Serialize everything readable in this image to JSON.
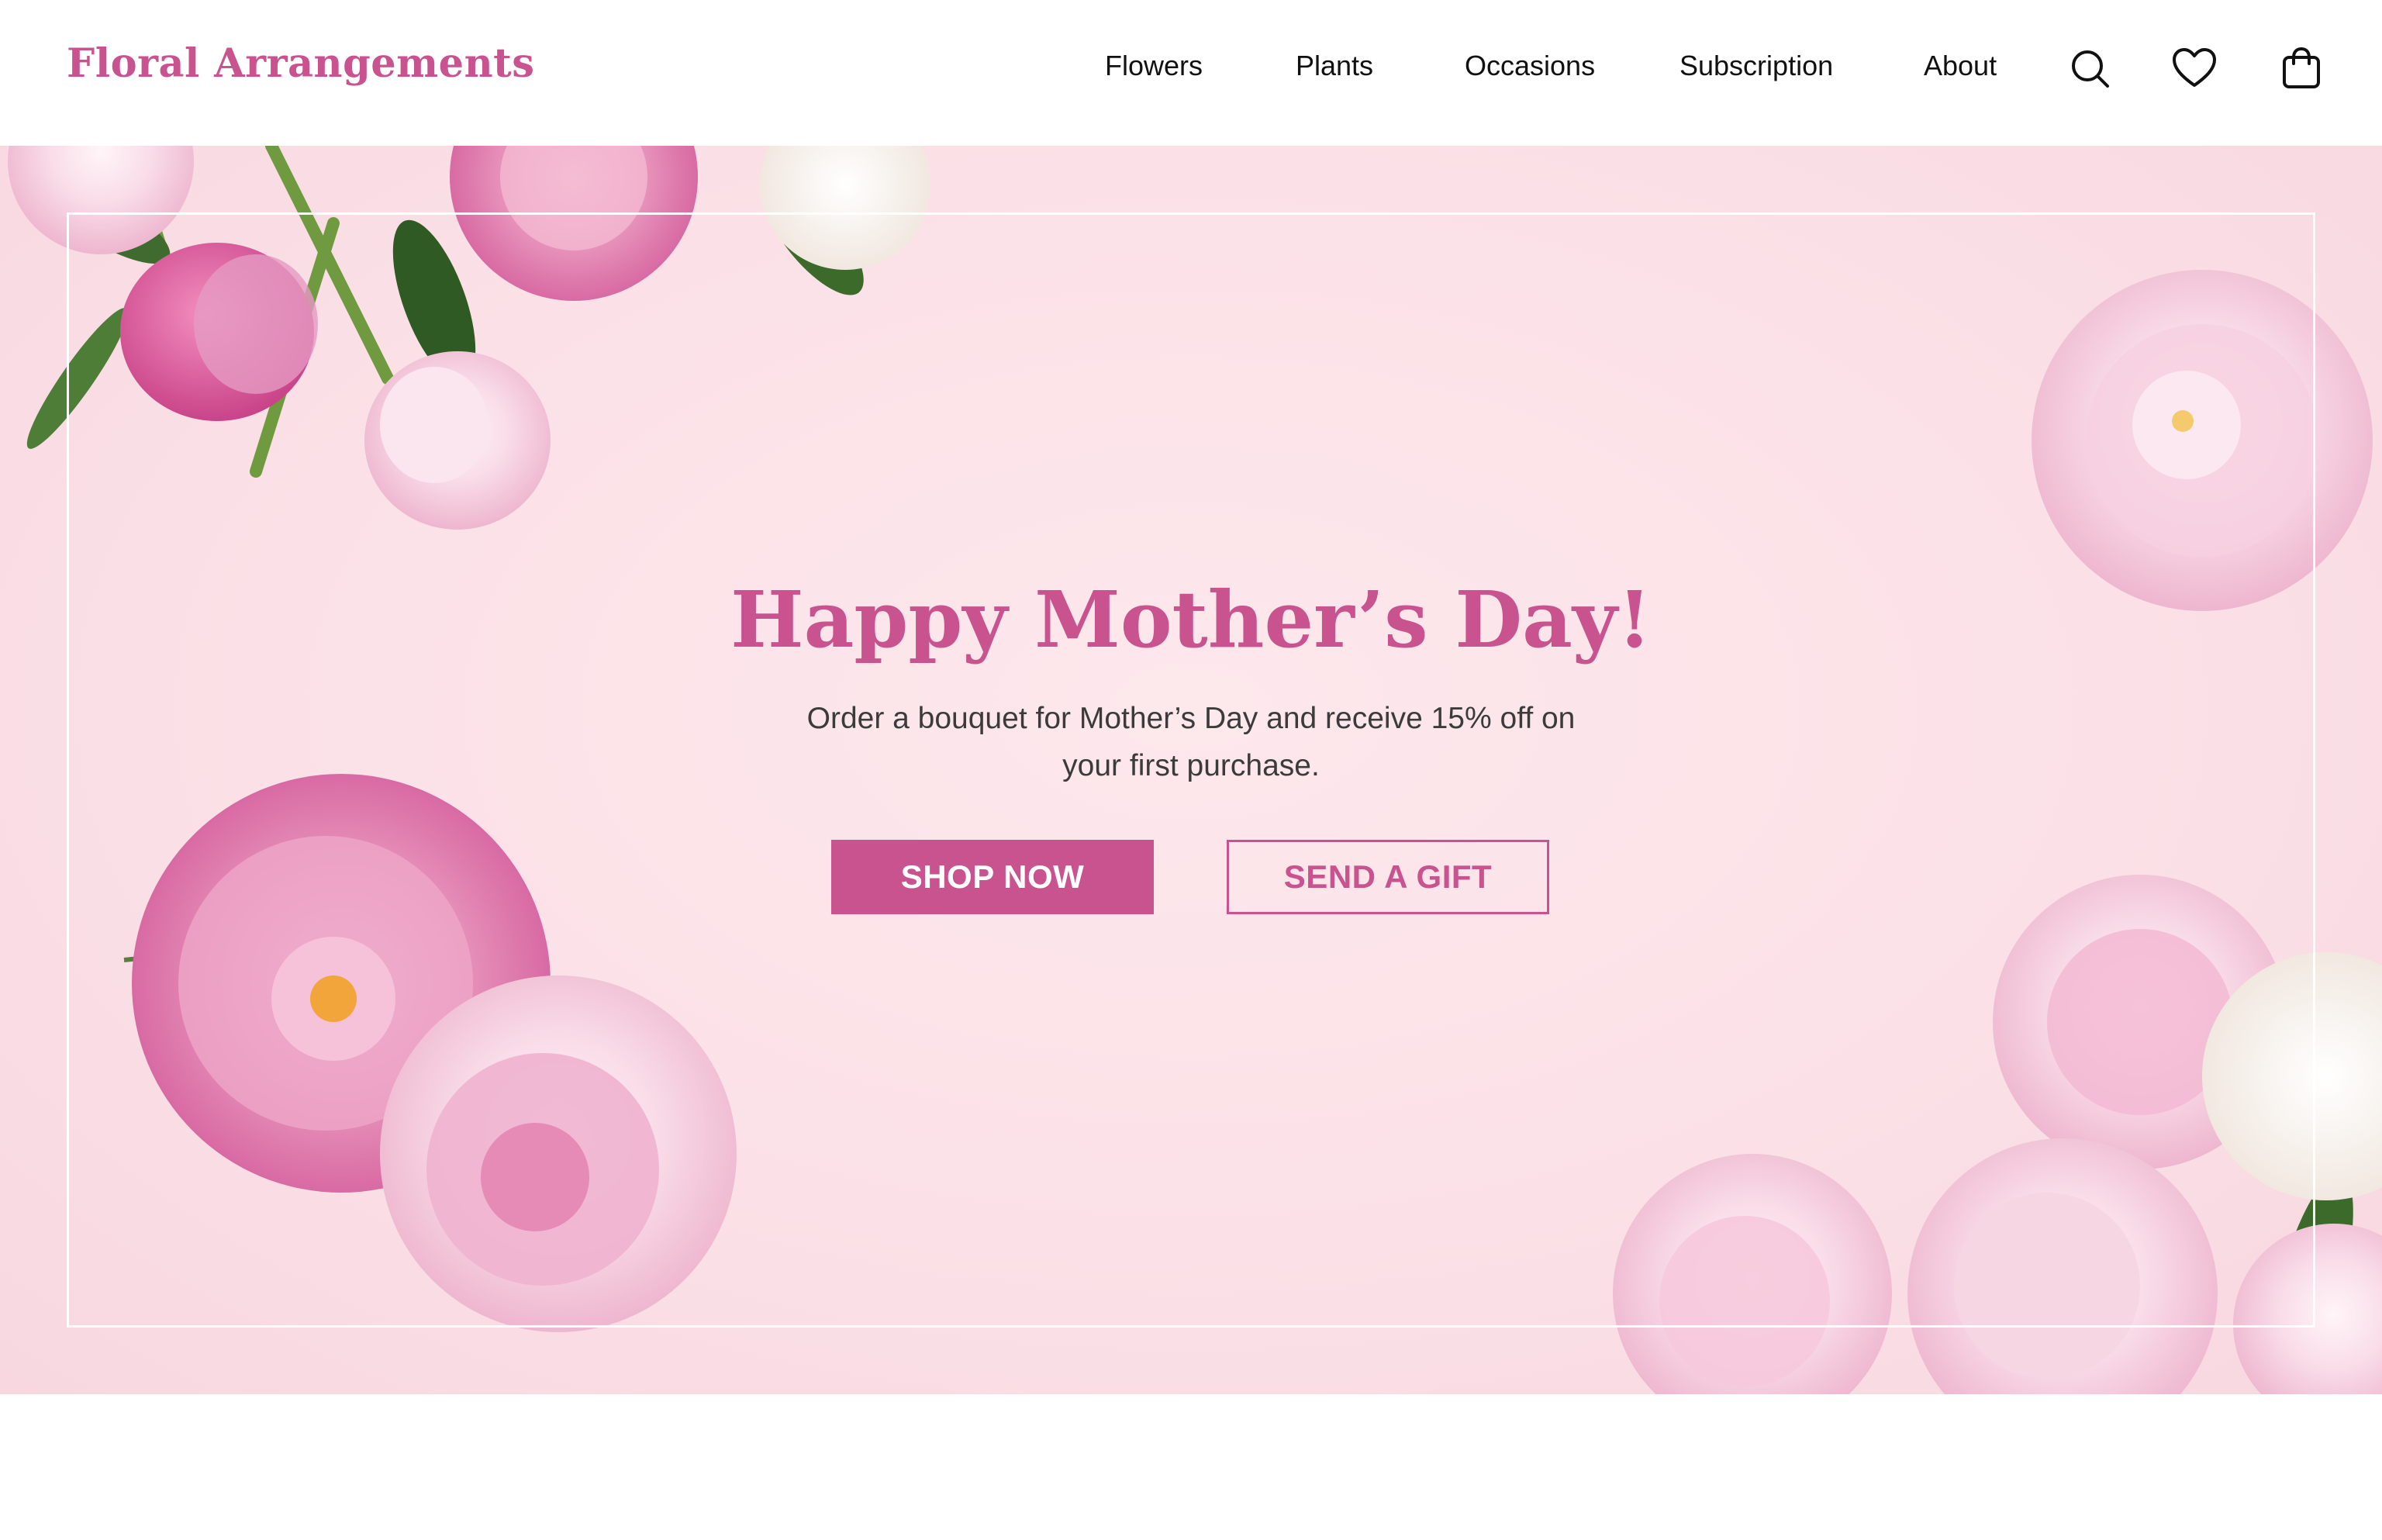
{
  "brand": {
    "name": "Floral Arrangements",
    "accent_color": "#c8538f"
  },
  "nav": {
    "items": [
      "Flowers",
      "Plants",
      "Occasions",
      "Subscription",
      "About"
    ],
    "icons": [
      "search-icon",
      "heart-icon",
      "shopping-bag-icon"
    ]
  },
  "hero": {
    "title": "Happy Mother’s Day!",
    "subtitle": "Order a bouquet for Mother’s Day and receive 15% off on your first purchase.",
    "primary_button": "SHOP NOW",
    "secondary_button": "SEND A GIFT",
    "background_color": "#fbe1e7"
  }
}
